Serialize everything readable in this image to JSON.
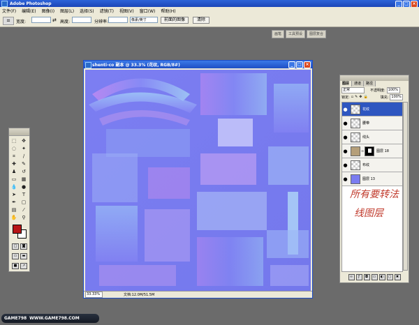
{
  "app": {
    "title": "Adobe Photoshop"
  },
  "menu": [
    "文件(F)",
    "编辑(E)",
    "图像(I)",
    "图层(L)",
    "选择(S)",
    "滤镜(T)",
    "视图(V)",
    "窗口(W)",
    "帮助(H)"
  ],
  "options": {
    "width_label": "宽度:",
    "height_label": "高度:",
    "resolution_label": "分辨率:",
    "unit_value": "像素/英寸",
    "front_image_button": "前面的图像",
    "clear_button": "清除"
  },
  "palette_well": [
    "画笔",
    "工具预设",
    "图层复合"
  ],
  "document": {
    "title": "shenti-co 副本 @ 33.3% (花纹, RGB/8#)",
    "zoom": "33.33%",
    "doc_info": "文档:12.0M/51.5M"
  },
  "layers_panel": {
    "tabs": [
      "图层",
      "通道",
      "路径"
    ],
    "blend_mode": "正常",
    "opacity_label": "不透明度:",
    "opacity_value": "100%",
    "lock_label": "锁定:",
    "fill_label": "填充:",
    "fill_value": "100%",
    "layers": [
      {
        "name": "花纹",
        "selected": true
      },
      {
        "name": "腰带",
        "selected": false
      },
      {
        "name": "线头",
        "selected": false
      },
      {
        "name": "图层 18",
        "selected": false
      },
      {
        "name": "布纹",
        "selected": false
      },
      {
        "name": "图层 13",
        "selected": false
      }
    ]
  },
  "annotation": {
    "line1": "所有要转法",
    "line2": "线图层",
    "color": "#c0392b"
  },
  "watermark": {
    "logo": "GAME798",
    "url": "WWW.GAME798.COM"
  },
  "colors": {
    "foreground": "#b71416",
    "background": "#ffffff",
    "canvas_base": "#7b7ff0"
  }
}
